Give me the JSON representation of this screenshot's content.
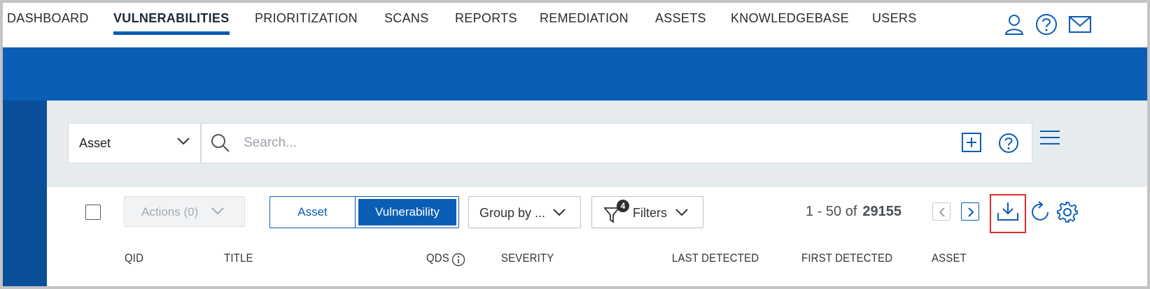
{
  "nav": {
    "tabs": [
      {
        "label": "DASHBOARD"
      },
      {
        "label": "VULNERABILITIES"
      },
      {
        "label": "PRIORITIZATION"
      },
      {
        "label": "SCANS"
      },
      {
        "label": "REPORTS"
      },
      {
        "label": "REMEDIATION"
      },
      {
        "label": "ASSETS"
      },
      {
        "label": "KNOWLEDGEBASE"
      },
      {
        "label": "USERS"
      }
    ],
    "active_tab": "VULNERABILITIES",
    "icons": [
      "user-icon",
      "help-icon",
      "mail-icon"
    ]
  },
  "search": {
    "scope": "Asset",
    "placeholder": "Search...",
    "value": ""
  },
  "toolbar": {
    "actions_label": "Actions (0)",
    "toggle": {
      "option1": "Asset",
      "option2": "Vulnerability",
      "selected": "Vulnerability"
    },
    "group_by_label": "Group by ...",
    "filters_label": "Filters",
    "filters_count": "4",
    "pagination_range": "1 - 50 of",
    "pagination_total": "29155"
  },
  "table": {
    "columns": [
      "QID",
      "TITLE",
      "QDS",
      "SEVERITY",
      "LAST DETECTED",
      "FIRST DETECTED",
      "ASSET"
    ]
  },
  "colors": {
    "brand_blue": "#0a5eb5",
    "dark_blue": "#0b4f9a",
    "highlight_red": "#e02b2b"
  }
}
